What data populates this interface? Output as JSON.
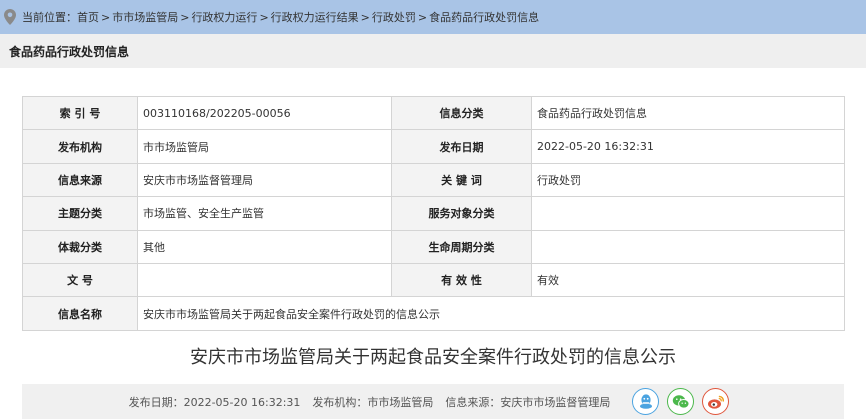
{
  "breadcrumb": {
    "lead": "当前位置：",
    "items": [
      "首页",
      "市市场监管局",
      "行政权力运行",
      "行政权力运行结果",
      "行政处罚",
      "食品药品行政处罚信息"
    ],
    "separator": ">"
  },
  "section_title": "食品药品行政处罚信息",
  "meta": {
    "index_label": "索 引 号",
    "index_value": "003110168/202205-00056",
    "category_label": "信息分类",
    "category_value": "食品药品行政处罚信息",
    "publisher_label": "发布机构",
    "publisher_value": "市市场监管局",
    "date_label": "发布日期",
    "date_value": "2022-05-20 16:32:31",
    "source_label": "信息来源",
    "source_value": "安庆市市场监督管理局",
    "keyword_label": "关 键 词",
    "keyword_value": "行政处罚",
    "topic_label": "主题分类",
    "topic_value": "市场监管、安全生产监管",
    "target_label": "服务对象分类",
    "target_value": "",
    "genre_label": "体裁分类",
    "genre_value": "其他",
    "lifecycle_label": "生命周期分类",
    "lifecycle_value": "",
    "docno_label": "文 号",
    "docno_value": "",
    "validity_label": "有 效 性",
    "validity_value": "有效",
    "name_label": "信息名称",
    "name_value": "安庆市市场监管局关于两起食品安全案件行政处罚的信息公示"
  },
  "article_title": "安庆市市场监管局关于两起食品安全案件行政处罚的信息公示",
  "footer": {
    "date": "发布日期：2022-05-20 16:32:31",
    "publisher": "发布机构：市市场监管局",
    "source": "信息来源：安庆市市场监督管理局"
  },
  "icons": {
    "location": "location-pin-icon",
    "qq": "qq-icon",
    "wechat": "wechat-icon",
    "weibo": "weibo-icon"
  },
  "colors": {
    "breadcrumb_bg": "#a9c4e6",
    "qq": "#4aa3e0",
    "wechat": "#4cb84c",
    "weibo": "#e0563c"
  }
}
